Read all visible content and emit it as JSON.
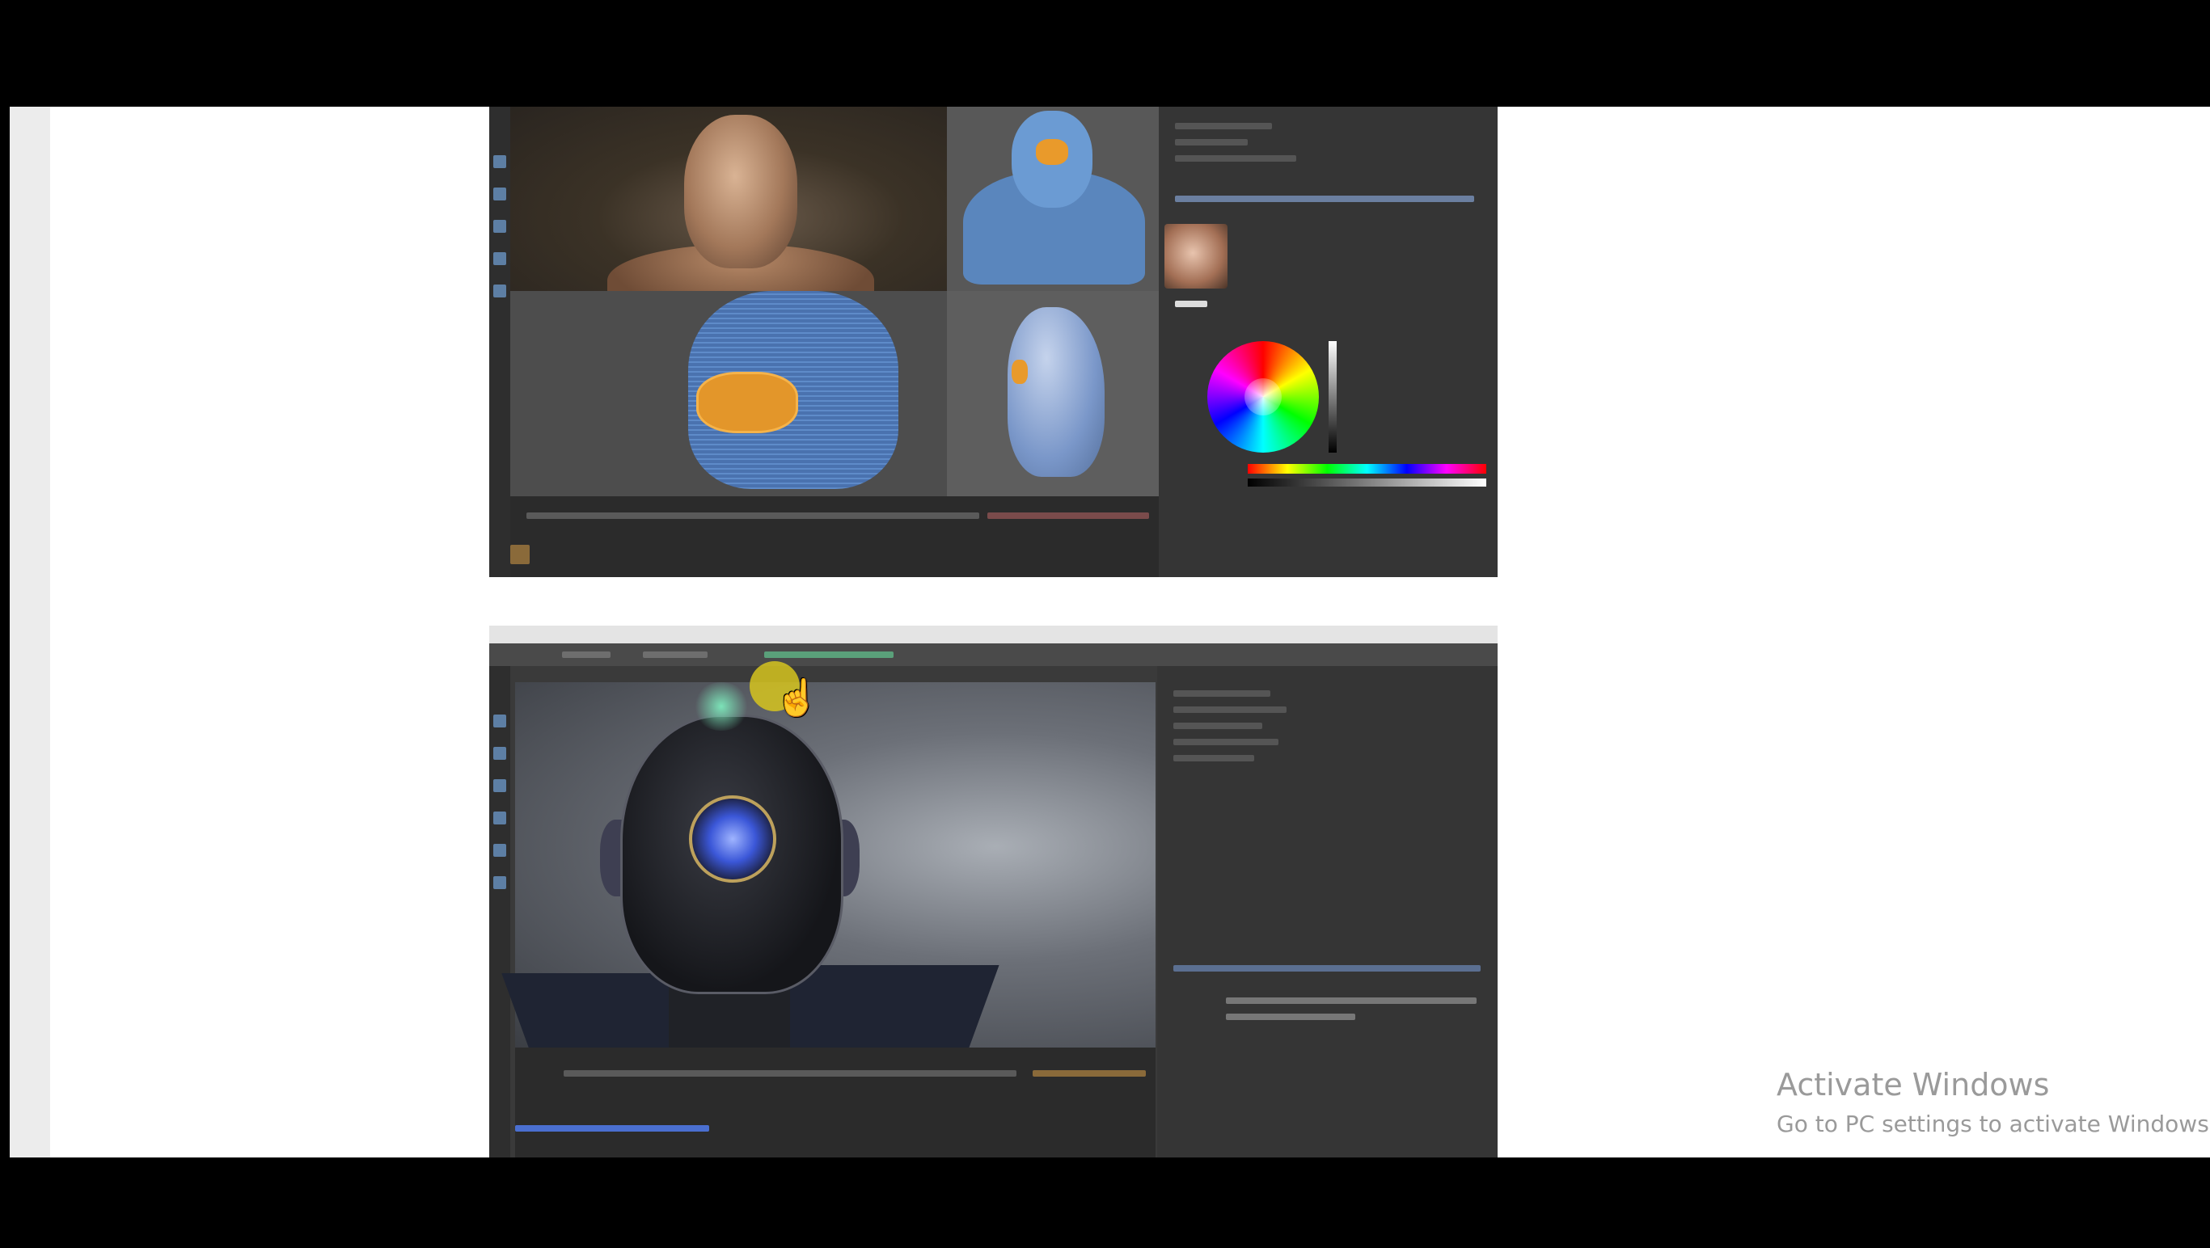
{
  "watermark": {
    "title": "Activate Windows",
    "subtitle": "Go to PC settings to activate Windows."
  },
  "screenshots": [
    {
      "subject": "face-texture-painting-viewports-with-color-picker"
    },
    {
      "subject": "robot-helmet-render-viewport"
    }
  ],
  "colors": {
    "letterbox": "#000000",
    "page_background": "#ffffff",
    "left_rail": "#ececec",
    "app_background": "#3a3a3a",
    "cursor_highlight": "#d6c41e"
  }
}
